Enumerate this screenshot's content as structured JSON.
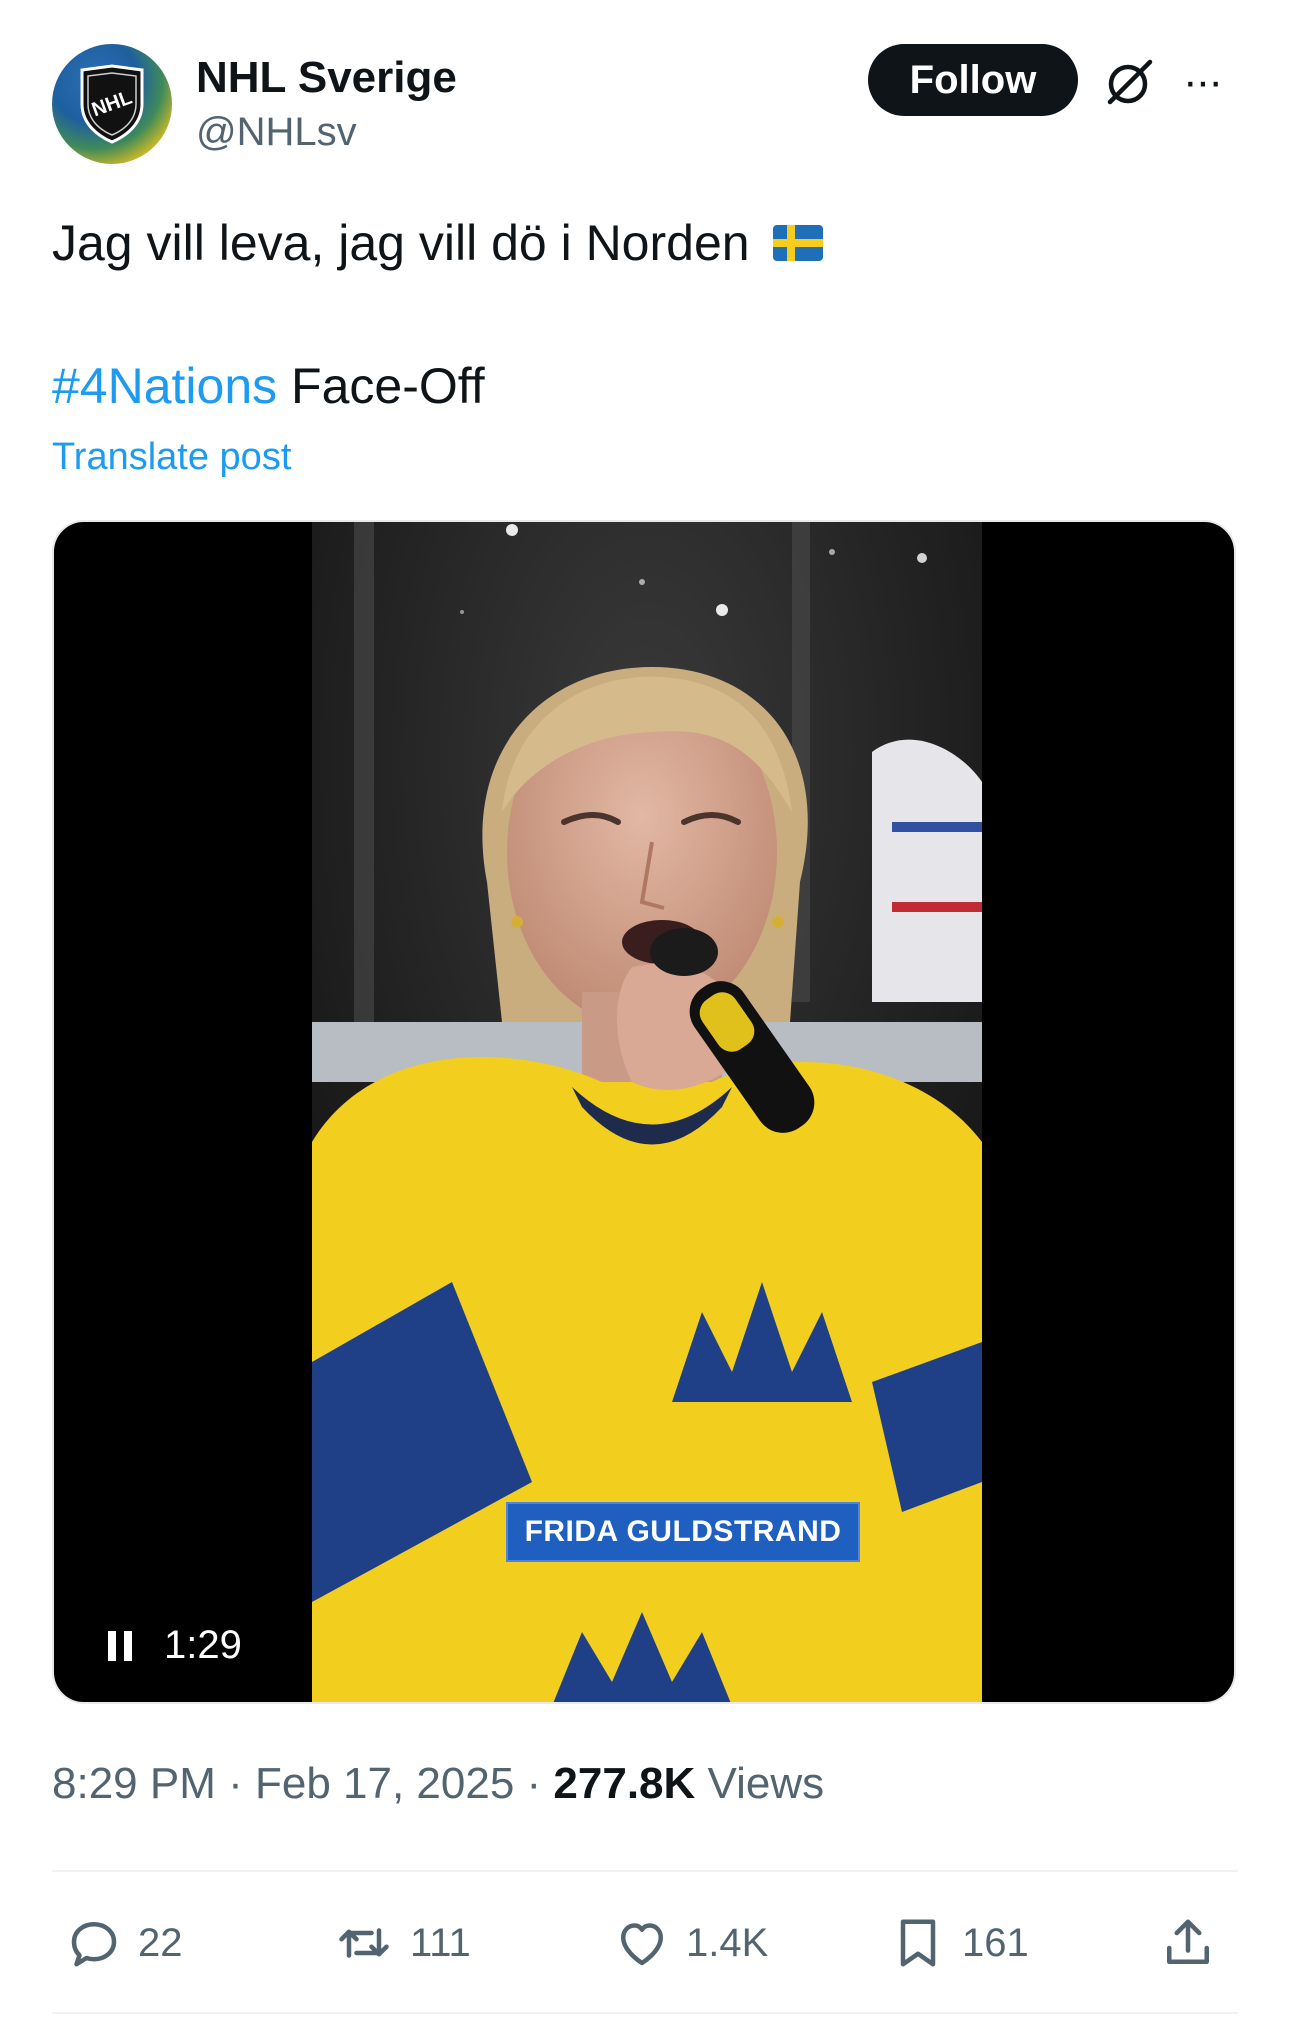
{
  "header": {
    "display_name": "NHL Sverige",
    "handle": "@NHLsv",
    "follow_label": "Follow",
    "more_label": "···",
    "avatar_icon": "nhl-shield-logo",
    "grok_icon": "grok-icon"
  },
  "post": {
    "text": "Jag vill leva, jag vill dö i Norden",
    "flag": "swedish-flag-emoji",
    "hashtag": "#4Nations",
    "hashtag_rest": " Face-Off",
    "translate_label": "Translate post"
  },
  "media": {
    "lower_third": "FRIDA GULDSTRAND",
    "time_remaining": "1:29",
    "state": "playing",
    "pause_icon": "pause-icon"
  },
  "meta": {
    "time": "8:29 PM",
    "sep1": " · ",
    "date": "Feb 17, 2025",
    "sep2": " · ",
    "views_count": "277.8K",
    "views_label": " Views"
  },
  "actions": {
    "replies": "22",
    "reposts": "111",
    "likes": "1.4K",
    "bookmarks": "161"
  },
  "colors": {
    "accent": "#1d9bf0",
    "text": "#0f1419",
    "muted": "#536471",
    "jersey_yellow": "#f2cf1f",
    "jersey_blue": "#1f3f86",
    "lower_third_blue": "#1f5fc0"
  }
}
